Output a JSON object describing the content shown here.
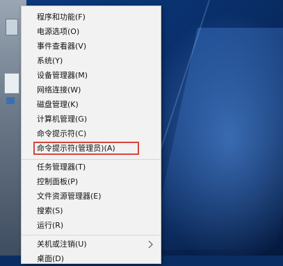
{
  "menu": {
    "items": [
      {
        "label": "程序和功能(F)"
      },
      {
        "label": "电源选项(O)"
      },
      {
        "label": "事件查看器(V)"
      },
      {
        "label": "系统(Y)"
      },
      {
        "label": "设备管理器(M)"
      },
      {
        "label": "网络连接(W)"
      },
      {
        "label": "磁盘管理(K)"
      },
      {
        "label": "计算机管理(G)"
      },
      {
        "label": "命令提示符(C)"
      },
      {
        "label": "命令提示符(管理员)(A)"
      },
      {
        "label": "任务管理器(T)"
      },
      {
        "label": "控制面板(P)"
      },
      {
        "label": "文件资源管理器(E)"
      },
      {
        "label": "搜索(S)"
      },
      {
        "label": "运行(R)"
      },
      {
        "label": "关机或注销(U)"
      },
      {
        "label": "桌面(D)"
      }
    ]
  },
  "colors": {
    "menu_bg": "#f2f2f2",
    "highlight_border": "#d6423a",
    "desktop": "#0a2e63"
  }
}
